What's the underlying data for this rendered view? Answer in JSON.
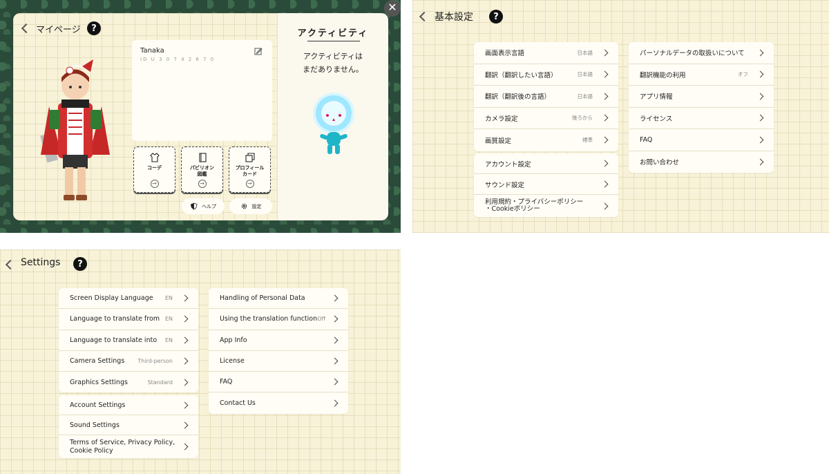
{
  "mypage": {
    "title": "マイページ",
    "help": "?",
    "profile": {
      "name": "Tanaka",
      "id": "ID U 3 0 7 4 2 6 7 0"
    },
    "tiles": [
      {
        "label_line1": "コーデ",
        "label_line2": ""
      },
      {
        "label_line1": "パビリオン",
        "label_line2": "図鑑"
      },
      {
        "label_line1": "プロフィール",
        "label_line2": "カード"
      }
    ],
    "help_button": "ヘルプ",
    "settings_button": "設定",
    "activity": {
      "title": "アクティビティ",
      "empty_line1": "アクティビティは",
      "empty_line2": "まだありません。"
    },
    "close": "✕"
  },
  "settings_jp": {
    "title": "基本設定",
    "help": "?",
    "group1": [
      {
        "label": "画面表示言語",
        "value": "日本語"
      },
      {
        "label": "翻訳（翻訳したい言語）",
        "value": "日本語"
      },
      {
        "label": "翻訳（翻訳後の言語）",
        "value": "日本語"
      },
      {
        "label": "カメラ設定",
        "value": "後ろから"
      },
      {
        "label": "画質設定",
        "value": "標準"
      }
    ],
    "group2": [
      {
        "label": "アカウント設定"
      },
      {
        "label": "サウンド設定"
      },
      {
        "label_line1": "利用規約・プライバシーポリシー",
        "label_line2": "・Cookieポリシー"
      }
    ],
    "group3": [
      {
        "label": "パーソナルデータの取扱いについて"
      },
      {
        "label": "翻訳機能の利用",
        "value": "オフ"
      },
      {
        "label": "アプリ情報"
      },
      {
        "label": "ライセンス"
      },
      {
        "label": "FAQ"
      },
      {
        "label": "お問い合わせ"
      }
    ]
  },
  "settings_en": {
    "title": "Settings",
    "help": "?",
    "group1": [
      {
        "label": "Screen Display Language",
        "value": "EN"
      },
      {
        "label": "Language to translate from",
        "value": "EN"
      },
      {
        "label": "Language to translate into",
        "value": "EN"
      },
      {
        "label": "Camera Settings",
        "value": "Third-person"
      },
      {
        "label": "Graphics Settings",
        "value": "Standard"
      }
    ],
    "group2": [
      {
        "label": "Account Settings"
      },
      {
        "label": "Sound Settings"
      },
      {
        "label_line1": "Terms of Service, Privacy Policy,",
        "label_line2": "Cookie Policy"
      }
    ],
    "group3": [
      {
        "label": "Handling of Personal Data"
      },
      {
        "label": "Using the translation function",
        "value": "Off"
      },
      {
        "label": "App Info"
      },
      {
        "label": "License"
      },
      {
        "label": "FAQ"
      },
      {
        "label": "Contact Us"
      }
    ]
  },
  "icons": {
    "back": "chevron-left-icon",
    "help": "question-icon",
    "row": "chevron-right-icon",
    "edit": "pencil-icon",
    "close": "close-icon",
    "coordinate": "tshirt-icon",
    "pavilion": "book-icon",
    "profile_card": "cards-icon",
    "shield": "shield-icon",
    "gear": "gear-icon"
  },
  "colors": {
    "background": "#f7f2d8",
    "card": "#fffdf6",
    "help_badge": "#111111"
  }
}
